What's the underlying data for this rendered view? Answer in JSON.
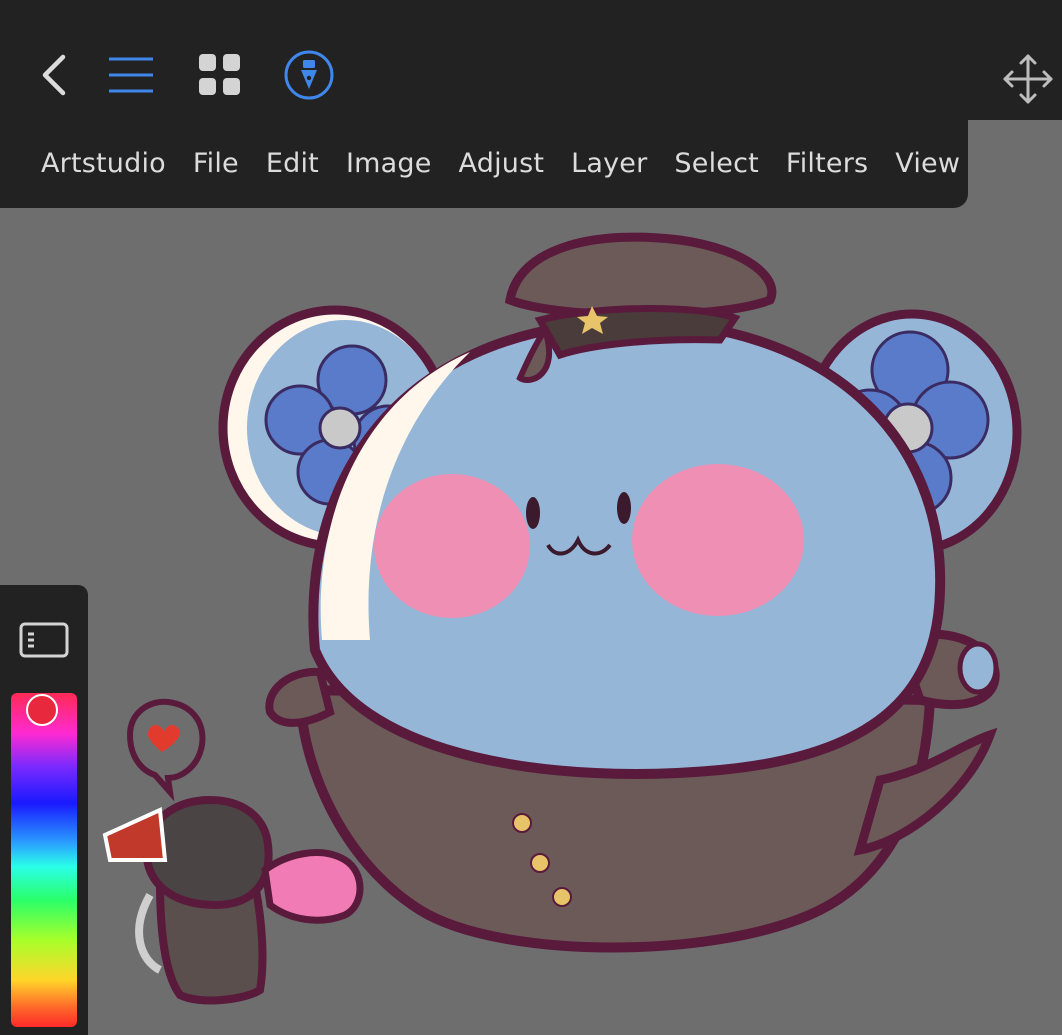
{
  "app": {
    "name": "Artstudio"
  },
  "toolbar": {
    "back_icon": "chevron-left-icon",
    "menu_icon": "hamburger-icon",
    "grid_icon": "grid-icon",
    "brush_icon": "brush-tool-icon",
    "move_icon": "move-arrows-icon"
  },
  "menu": {
    "items": [
      "Artstudio",
      "File",
      "Edit",
      "Image",
      "Adjust",
      "Layer",
      "Select",
      "Filters",
      "View"
    ]
  },
  "colors": {
    "toolbar_bg": "#232222",
    "canvas_bg": "#6e6e6e",
    "accent": "#3f87ea",
    "current_color": "#e8283c"
  }
}
